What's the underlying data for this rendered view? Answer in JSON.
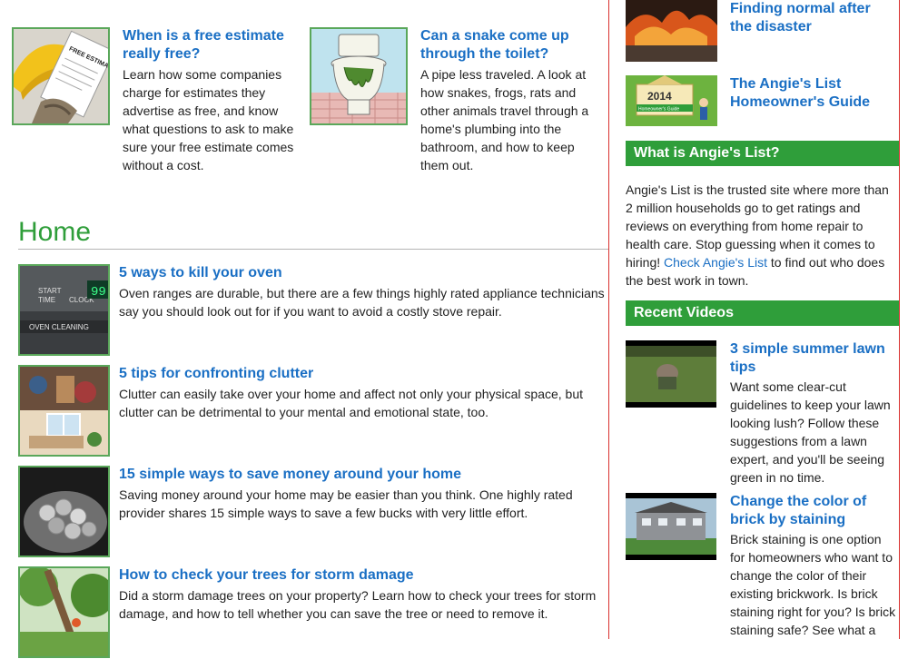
{
  "top_articles": [
    {
      "title": "When is a free estimate really free?",
      "summary": "Learn how some companies charge for estimates they advertise as free, and know what questions to ask to make sure your free estimate comes without a cost.",
      "image_text": "FREE ESTIMATE"
    },
    {
      "title": "Can a snake come up through the toilet?",
      "summary": "A pipe less traveled. A look at how snakes, frogs, rats and other animals travel through a home's plumbing into the bathroom, and how to keep them out."
    }
  ],
  "home_section": {
    "heading": "Home",
    "items": [
      {
        "title": "5 ways to kill your oven",
        "summary": "Oven ranges are durable, but there are a few things highly rated appliance technicians say you should look out for if you want to avoid a costly stove repair."
      },
      {
        "title": "5 tips for confronting clutter",
        "summary": "Clutter can easily take over your home and affect not only your physical space, but clutter can be detrimental to your mental and emotional state, too."
      },
      {
        "title": "15 simple ways to save money around your home",
        "summary": "Saving money around your home may be easier than you think. One highly rated provider shares 15 simple ways to save a few bucks with very little effort."
      },
      {
        "title": "How to check your trees for storm damage",
        "summary": "Did a storm damage trees on your property? Learn how to check your trees for storm damage, and how to tell whether you can save the tree or need to remove it."
      }
    ]
  },
  "sidebar": {
    "promos": [
      {
        "title": "Finding normal after the disaster"
      },
      {
        "title": "The Angie's List Homeowner's Guide",
        "image_year": "2014",
        "image_caption": "Homeowner's Guide"
      }
    ],
    "about": {
      "heading": "What is Angie's List?",
      "text_before": "Angie's List is the trusted site where more than 2 million households go to get ratings and reviews on everything from home repair to health care. Stop guessing when it comes to hiring! ",
      "link": "Check Angie's List",
      "text_after": " to find out who does the best work in town."
    },
    "videos": {
      "heading": "Recent Videos",
      "items": [
        {
          "title": "3 simple summer lawn tips",
          "summary": "Want some clear-cut guidelines to keep your lawn looking lush? Follow these suggestions from a lawn expert, and you'll be seeing green in no time."
        },
        {
          "title": "Change the color of brick by staining",
          "summary": "Brick staining is one option for homeowners who want to change the color of their existing brickwork. Is brick staining right for you? Is brick staining safe? See what a"
        }
      ]
    }
  },
  "colors": {
    "link_blue": "#1a6fc4",
    "brand_green": "#2f9e3a",
    "divider_red": "#d9302e"
  }
}
